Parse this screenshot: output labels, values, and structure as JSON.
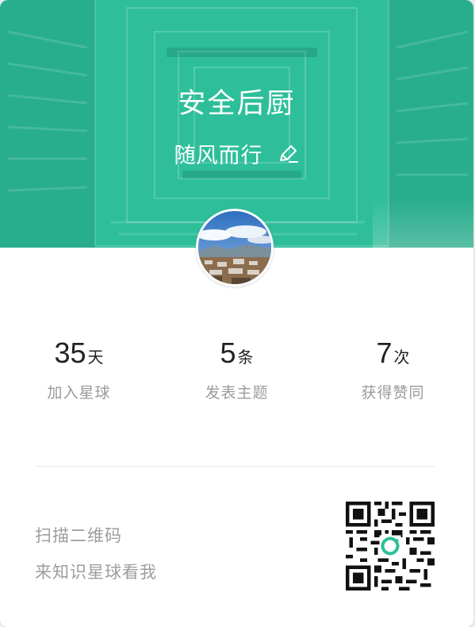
{
  "planet": {
    "title": "安全后厨",
    "owner_name": "随风而行",
    "edit_icon": "edit-pencil-icon",
    "banner_color": "#2ebf9a"
  },
  "stats": [
    {
      "value": "35",
      "unit": "天",
      "label": "加入星球"
    },
    {
      "value": "5",
      "unit": "条",
      "label": "发表主题"
    },
    {
      "value": "7",
      "unit": "次",
      "label": "获得赞同"
    }
  ],
  "scan": {
    "line1": "扫描二维码",
    "line2": "来知识星球看我",
    "qr_icon": "qr-code-icon",
    "qr_logo_color": "#2ebf9a"
  }
}
